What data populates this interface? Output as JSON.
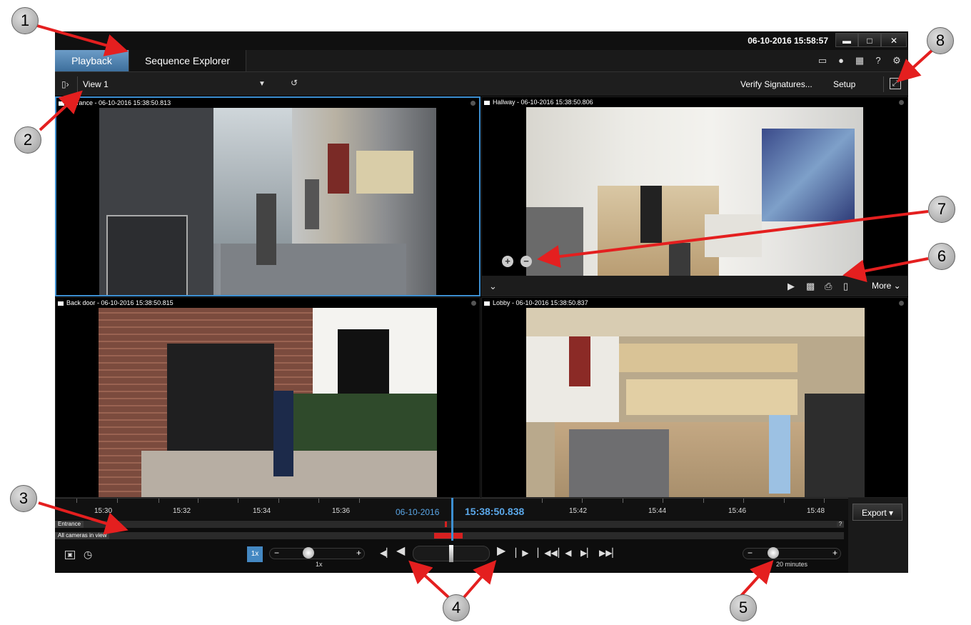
{
  "titlebar": {
    "datetime": "06-10-2016 15:58:57"
  },
  "tabs": [
    {
      "label": "Playback",
      "active": true
    },
    {
      "label": "Sequence Explorer",
      "active": false
    }
  ],
  "toolbar": {
    "view_name": "View 1",
    "verify_signatures": "Verify Signatures...",
    "setup": "Setup"
  },
  "tiles": {
    "entrance": "Entrance - 06-10-2016 15:38:50.813",
    "hallway": "Hallway - 06-10-2016 15:38:50.806",
    "backdoor": "Back door - 06-10-2016 15:38:50.815",
    "lobby": "Lobby - 06-10-2016 15:38:50.837"
  },
  "hallway_bar": {
    "more": "More"
  },
  "timeline": {
    "ticks": [
      "15:30",
      "15:32",
      "15:34",
      "15:36",
      "15:42",
      "15:44",
      "15:46",
      "15:48"
    ],
    "date": "06-10-2016",
    "time": "15:38:50.838",
    "tracks": [
      "Entrance",
      "All cameras in view"
    ],
    "track_help": "?",
    "speed_box": "1x",
    "speed_label": "1x",
    "span_label": "20 minutes"
  },
  "export": {
    "label": "Export"
  },
  "callouts": [
    "1",
    "2",
    "3",
    "4",
    "5",
    "6",
    "7",
    "8"
  ],
  "colors": {
    "accent": "#3d8fd1",
    "active_tab": "#4f86b8",
    "timecode": "#5aa7e8",
    "sequence_marker": "#d62020"
  }
}
